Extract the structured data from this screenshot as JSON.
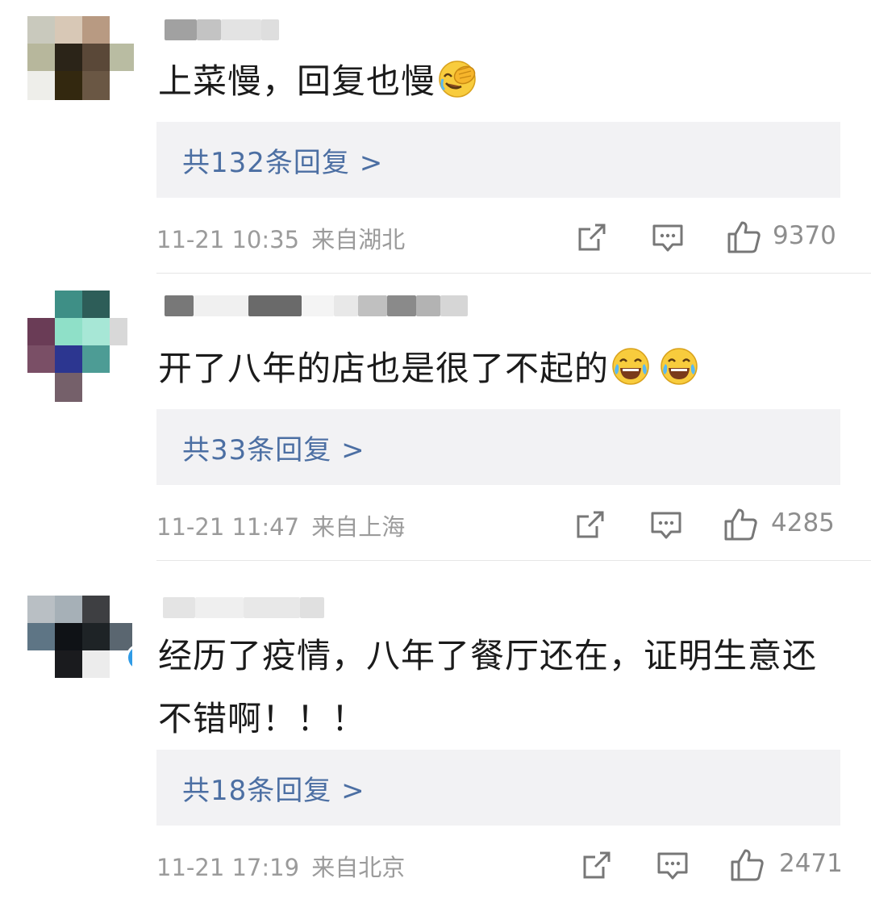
{
  "comments": [
    {
      "text": "上菜慢，回复也慢",
      "emoji": [
        "facepalm-laugh"
      ],
      "reply_summary": "共132条回复 >",
      "time": "11-21 10:35",
      "location": "来自湖北",
      "likes": "9370"
    },
    {
      "text": "开了八年的店也是很了不起的",
      "emoji": [
        "tears-of-joy",
        "tears-of-joy"
      ],
      "reply_summary": "共33条回复 >",
      "time": "11-21 11:47",
      "location": "来自上海",
      "likes": "4285"
    },
    {
      "text": "经历了疫情，八年了餐厅还在，证明生意还不错啊！！！",
      "emoji": [],
      "reply_summary": "共18条回复 >",
      "time": "11-21 17:19",
      "location": "来自北京",
      "likes": "2471",
      "verified": true
    }
  ],
  "colors": {
    "link": "#4c6fa3",
    "meta": "#9b9b9b",
    "reply_bg": "#f2f2f4",
    "verified": "#2f9be6"
  },
  "icons": [
    "share-icon",
    "comment-icon",
    "like-icon"
  ]
}
